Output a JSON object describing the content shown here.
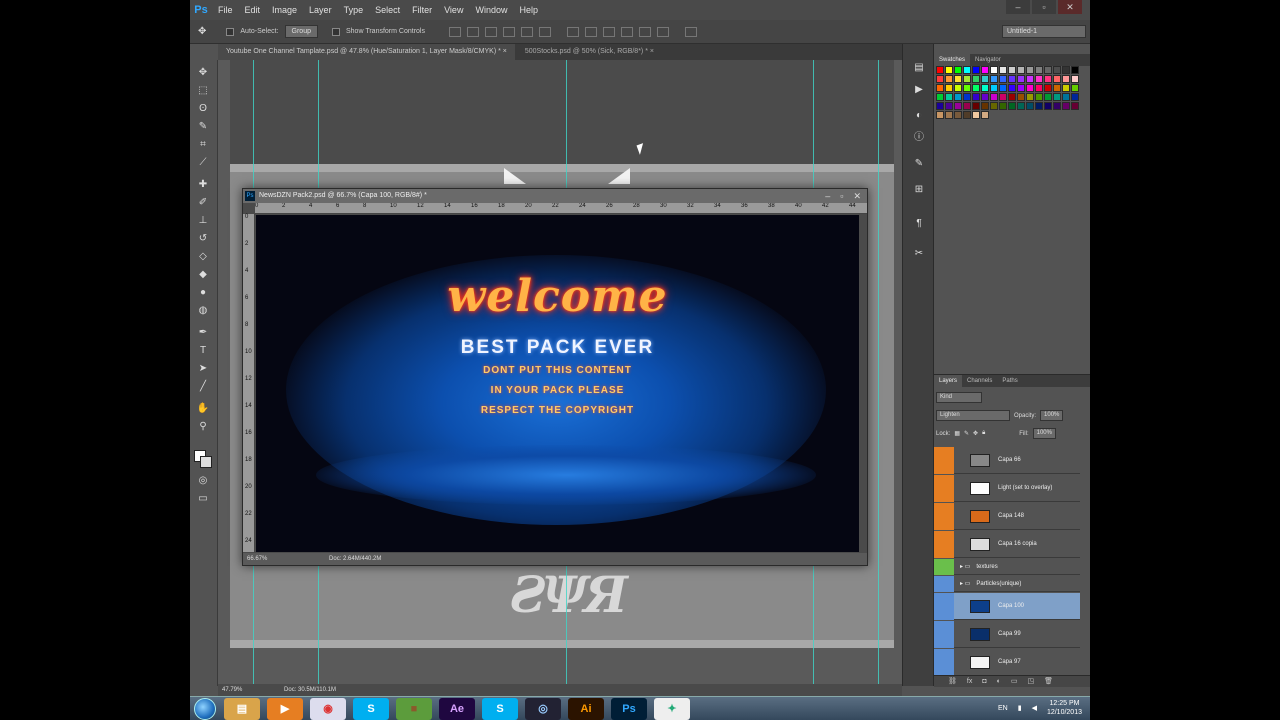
{
  "app": {
    "logo": "Ps"
  },
  "menu": [
    "File",
    "Edit",
    "Image",
    "Layer",
    "Type",
    "Select",
    "Filter",
    "View",
    "Window",
    "Help"
  ],
  "options_bar": {
    "auto_select_label": "Auto-Select:",
    "auto_select_value": "Group",
    "transform_label": "Show Transform Controls",
    "workspace": "Untitled-1"
  },
  "tabs": [
    {
      "label": "Youtube One Channel Tamplate.psd @ 47.8% (Hue/Saturation 1, Layer Mask/8/CMYK) *",
      "close": "×"
    },
    {
      "label": "500Stocks.psd @ 50% (Sick, RGB/8*) *",
      "close": "×"
    }
  ],
  "float_window": {
    "title": "NewsDZN Pack2.psd @ 66.7% (Capa 100, RGB/8#) *",
    "status_zoom": "66.67%",
    "status_doc": "Doc: 2.64M/440.2M",
    "ruler_h": [
      "0",
      "2",
      "4",
      "6",
      "8",
      "10",
      "12",
      "14",
      "16",
      "18",
      "20",
      "22",
      "24",
      "26",
      "28",
      "30",
      "32",
      "34",
      "36",
      "38",
      "40",
      "42",
      "44"
    ],
    "ruler_v": [
      "0",
      "2",
      "4",
      "6",
      "8",
      "10",
      "12",
      "14",
      "16",
      "18",
      "20",
      "22",
      "24"
    ]
  },
  "artwork": {
    "welcome": "welcome",
    "subtitle": "BEST PACK EVER",
    "line1": "DONT PUT THIS CONTENT",
    "line2": "IN YOUR PACK PLEASE",
    "line3": "RESPECT THE COPYRIGHT"
  },
  "main_status": {
    "zoom": "47.79%",
    "doc": "Doc: 30.5M/110.1M"
  },
  "swatches_panel": {
    "tabs": [
      "Swatches",
      "Navigator"
    ],
    "colors": [
      "#ff0000",
      "#ffff00",
      "#00ff00",
      "#00ffff",
      "#0000ff",
      "#ff00ff",
      "#ffffff",
      "#e6e6e6",
      "#cccccc",
      "#b3b3b3",
      "#999999",
      "#808080",
      "#666666",
      "#4d4d4d",
      "#333333",
      "#000000",
      "#ff3b3b",
      "#ff9933",
      "#ffe033",
      "#a6e633",
      "#33cc66",
      "#33cccc",
      "#3399ff",
      "#3366ff",
      "#6633ff",
      "#9933ff",
      "#cc33ff",
      "#ff33cc",
      "#ff3380",
      "#ff6666",
      "#ff9999",
      "#ffcccc",
      "#ff6600",
      "#ffcc00",
      "#ccff00",
      "#66ff00",
      "#00ff66",
      "#00ffcc",
      "#00ccff",
      "#0066ff",
      "#3300ff",
      "#9900ff",
      "#ff00cc",
      "#ff0066",
      "#cc0000",
      "#cc6600",
      "#cccc00",
      "#66cc00",
      "#00cc33",
      "#00cc99",
      "#0099cc",
      "#0033cc",
      "#3300cc",
      "#6600cc",
      "#cc00cc",
      "#cc0066",
      "#990000",
      "#994d00",
      "#999900",
      "#4d9900",
      "#009933",
      "#009980",
      "#007399",
      "#002699",
      "#1a0099",
      "#4d0099",
      "#990099",
      "#99004d",
      "#660000",
      "#663300",
      "#666600",
      "#336600",
      "#006622",
      "#006655",
      "#004d66",
      "#001a66",
      "#110066",
      "#330066",
      "#660066",
      "#660033",
      "#c89664",
      "#a07850",
      "#785a3c",
      "#503c28",
      "#f0c8a0",
      "#d2aa82"
    ]
  },
  "layers_panel": {
    "tabs": [
      "Layers",
      "Channels",
      "Paths"
    ],
    "kind": "Kind",
    "blend_mode": "Lighten",
    "opacity_label": "Opacity:",
    "opacity_value": "100%",
    "lock_label": "Lock:",
    "fill_label": "Fill:",
    "fill_value": "100%",
    "layers": [
      {
        "name": "Capa 66",
        "eye": "#e67e22",
        "thumb": "#888888",
        "selected": false
      },
      {
        "name": "Light (set to overlay)",
        "eye": "#e67e22",
        "thumb": "#ffffff",
        "selected": false
      },
      {
        "name": "Capa 148",
        "eye": "#e67e22",
        "thumb": "#d96a1a",
        "selected": false
      },
      {
        "name": "Capa 16 copia",
        "eye": "#e67e22",
        "thumb": "#dddddd",
        "selected": false
      }
    ],
    "groups": [
      {
        "name": "textures",
        "eye": "#6abf4b"
      },
      {
        "name": "Particles(unique)",
        "eye": "#5b8fd6"
      }
    ],
    "layers2": [
      {
        "name": "Capa 100",
        "eye": "#5b8fd6",
        "thumb": "#0d3f8a",
        "selected": true
      },
      {
        "name": "Capa 99",
        "eye": "#5b8fd6",
        "thumb": "#0a2f6a",
        "selected": false
      },
      {
        "name": "Capa 97",
        "eye": "#5b8fd6",
        "thumb": "#f4f4f4",
        "selected": false
      }
    ]
  },
  "taskbar": {
    "apps": [
      {
        "name": "explorer",
        "label": "▤",
        "bg": "#d9a44a",
        "fg": "#fff"
      },
      {
        "name": "media",
        "label": "▶",
        "bg": "#e67e22",
        "fg": "#fff"
      },
      {
        "name": "chrome",
        "label": "◉",
        "bg": "#dde",
        "fg": "#d33"
      },
      {
        "name": "skype",
        "label": "S",
        "bg": "#00aff0",
        "fg": "#fff"
      },
      {
        "name": "minecraft",
        "label": "■",
        "bg": "#5c9c3c",
        "fg": "#8b5a2b"
      },
      {
        "name": "after-effects",
        "label": "Ae",
        "bg": "#1f0740",
        "fg": "#d8a1ff"
      },
      {
        "name": "skype2",
        "label": "S",
        "bg": "#00aff0",
        "fg": "#fff"
      },
      {
        "name": "cinema",
        "label": "◎",
        "bg": "#223",
        "fg": "#9cf"
      },
      {
        "name": "illustrator",
        "label": "Ai",
        "bg": "#2b1300",
        "fg": "#ff9a00"
      },
      {
        "name": "photoshop",
        "label": "Ps",
        "bg": "#001e36",
        "fg": "#31a8ff"
      },
      {
        "name": "tool",
        "label": "✦",
        "bg": "#eee",
        "fg": "#2a7"
      }
    ],
    "lang": "EN",
    "time": "12:25 PM",
    "date": "12/10/2013"
  }
}
